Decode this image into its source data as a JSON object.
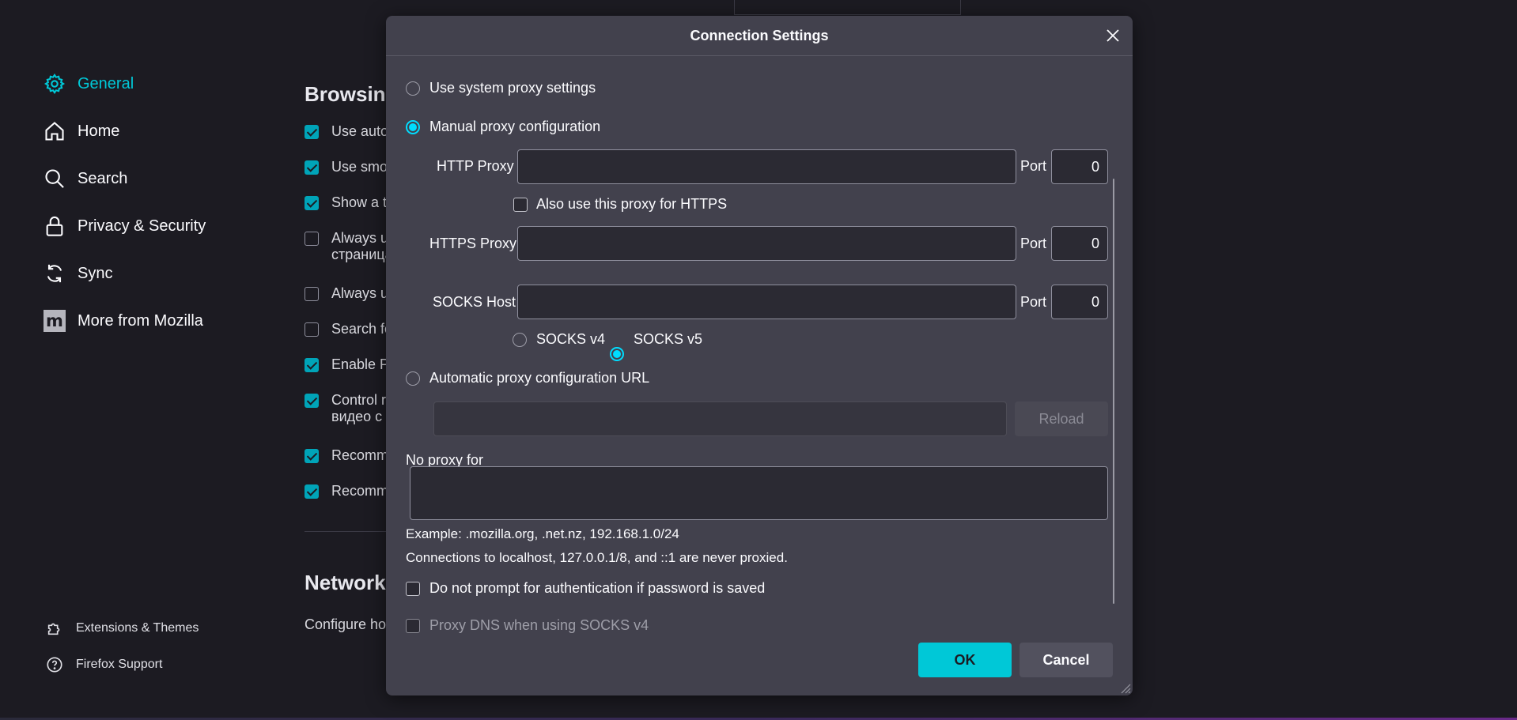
{
  "sidebar": {
    "items": [
      {
        "label": "General",
        "icon": "gear-icon",
        "active": true
      },
      {
        "label": "Home",
        "icon": "home-icon"
      },
      {
        "label": "Search",
        "icon": "search-icon"
      },
      {
        "label": "Privacy & Security",
        "icon": "lock-icon"
      },
      {
        "label": "Sync",
        "icon": "sync-icon"
      },
      {
        "label": "More from Mozilla",
        "icon": "mozilla-icon"
      }
    ],
    "footer": [
      {
        "label": "Extensions & Themes",
        "icon": "puzzle-icon"
      },
      {
        "label": "Firefox Support",
        "icon": "help-icon"
      }
    ]
  },
  "background": {
    "browsing_heading": "Browsing",
    "rows": [
      {
        "text": "Use auto",
        "checked": true
      },
      {
        "text": "Use smoo",
        "checked": true
      },
      {
        "text": "Show a t",
        "checked": true
      },
      {
        "text": "Always u",
        "text2": "страница",
        "checked": false
      },
      {
        "text": "Always u",
        "checked": false
      },
      {
        "text": "Search fo",
        "checked": false
      },
      {
        "text": "Enable Pi",
        "checked": true
      },
      {
        "text": "Control r",
        "text2": "видео с н",
        "checked": true
      },
      {
        "text": "Recomm",
        "checked": true
      },
      {
        "text": "Recomm",
        "checked": true
      }
    ],
    "network_heading": "Network",
    "network_text": "Configure ho"
  },
  "dialog": {
    "title": "Connection Settings",
    "options": {
      "system": "Use system proxy settings",
      "manual": "Manual proxy configuration",
      "auto": "Automatic proxy configuration URL"
    },
    "http_proxy_label": "HTTP Proxy",
    "http_proxy_value": "",
    "http_port_label": "Port",
    "http_port_value": "0",
    "also_https_label": "Also use this proxy for HTTPS",
    "https_proxy_label": "HTTPS Proxy",
    "https_proxy_value": "",
    "https_port_label": "Port",
    "https_port_value": "0",
    "socks_host_label": "SOCKS Host",
    "socks_host_value": "",
    "socks_port_label": "Port",
    "socks_port_value": "0",
    "socks_v4_label": "SOCKS v4",
    "socks_v5_label": "SOCKS v5",
    "auto_url_value": "",
    "reload_label": "Reload",
    "no_proxy_label": "No proxy for",
    "no_proxy_value": "",
    "example_text": "Example: .mozilla.org, .net.nz, 192.168.1.0/24",
    "localhost_text": "Connections to localhost, 127.0.0.1/8, and ::1 are never proxied.",
    "no_prompt_label": "Do not prompt for authentication if password is saved",
    "proxy_dns_label": "Proxy DNS when using SOCKS v4",
    "ok_label": "OK",
    "cancel_label": "Cancel"
  },
  "colors": {
    "accent": "#00c8d7",
    "radio_accent": "#00ddff",
    "dialog_bg": "#42414d",
    "page_bg": "#1c1b22"
  }
}
